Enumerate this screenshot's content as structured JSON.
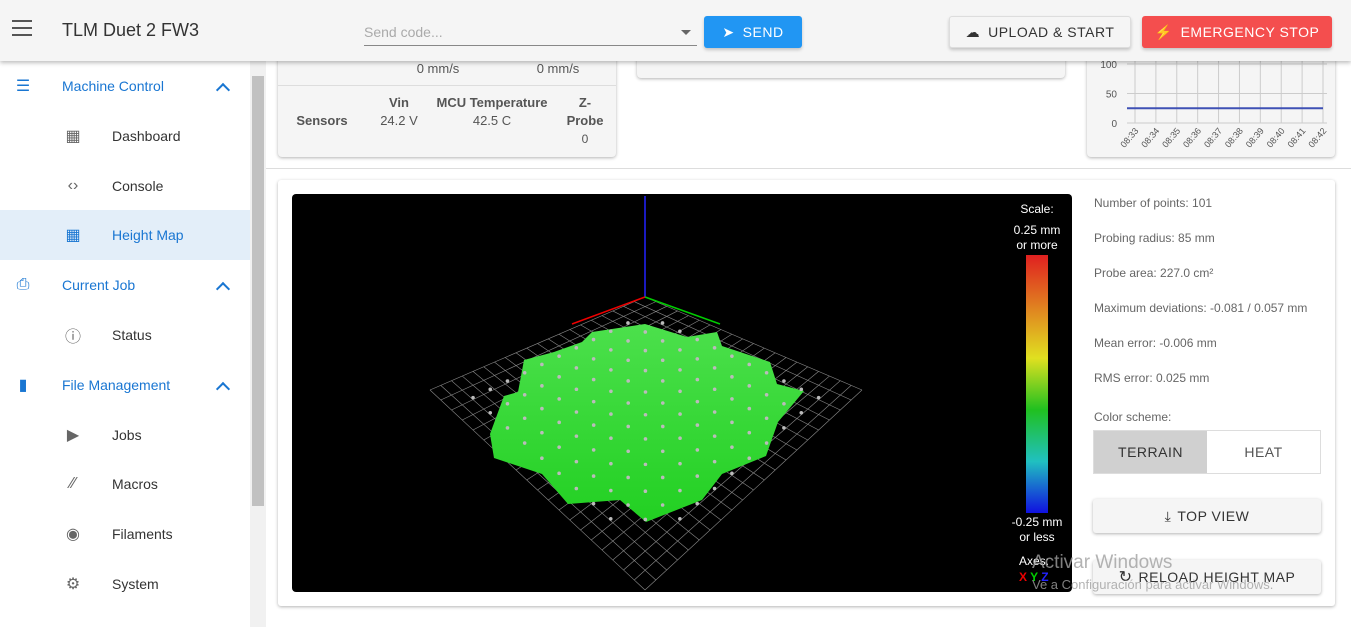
{
  "header": {
    "title": "TLM Duet 2 FW3",
    "code_placeholder": "Send code...",
    "send": "SEND",
    "upload": "UPLOAD & START",
    "estop": "EMERGENCY STOP"
  },
  "sidebar": {
    "items": [
      {
        "label": "Machine Control",
        "icon": "sliders-icon",
        "group": true
      },
      {
        "label": "Dashboard",
        "icon": "dashboard-icon"
      },
      {
        "label": "Console",
        "icon": "code-icon"
      },
      {
        "label": "Height Map",
        "icon": "grid-icon",
        "active": true
      },
      {
        "label": "Current Job",
        "icon": "printer-icon",
        "group": true
      },
      {
        "label": "Status",
        "icon": "info-icon"
      },
      {
        "label": "File Management",
        "icon": "sd-card-icon",
        "group": true
      },
      {
        "label": "Jobs",
        "icon": "play-icon"
      },
      {
        "label": "Macros",
        "icon": "code-slash-icon"
      },
      {
        "label": "Filaments",
        "icon": "radio-icon"
      },
      {
        "label": "System",
        "icon": "gear-icon"
      }
    ]
  },
  "status": {
    "speed1": "0 mm/s",
    "speed2": "0 mm/s",
    "sensors_label": "Sensors",
    "vin_label": "Vin",
    "vin": "24.2 V",
    "mcu_label": "MCU Temperature",
    "mcu": "42.5 C",
    "zprobe_label_1": "Z-",
    "zprobe_label_2": "Probe",
    "zprobe": "0"
  },
  "temp_chart": {
    "type": "line",
    "y_ticks": [
      "100",
      "50",
      "0"
    ],
    "x_ticks": [
      "08:33",
      "08:34",
      "08:35",
      "08:36",
      "08:37",
      "08:38",
      "08:39",
      "08:40",
      "08:41",
      "08:42"
    ],
    "ylim": [
      0,
      100
    ],
    "series": [
      {
        "values": [
          25,
          25,
          25,
          25,
          25,
          25,
          25,
          25,
          25,
          25
        ],
        "color": "#3f51b5"
      }
    ]
  },
  "heightmap": {
    "scale_label": "Scale:",
    "max_1": "0.25 mm",
    "max_2": "or more",
    "min_1": "-0.25 mm",
    "min_2": "or less",
    "axes_label": "Axes:",
    "x": "X",
    "y": "Y",
    "z": "Z",
    "points": "Number of points: 101",
    "radius": "Probing radius: 85 mm",
    "area": "Probe area: 227.0 cm²",
    "maxdev": "Maximum deviations: -0.081 / 0.057 mm",
    "mean": "Mean error: -0.006 mm",
    "rms": "RMS error: 0.025 mm",
    "scheme_label": "Color scheme:",
    "terrain": "TERRAIN",
    "heat": "HEAT",
    "top_view": "TOP VIEW",
    "reload": "RELOAD HEIGHT MAP"
  },
  "watermark": {
    "line1": "Activar Windows",
    "line2": "Ve a Configuración para activar Windows."
  }
}
